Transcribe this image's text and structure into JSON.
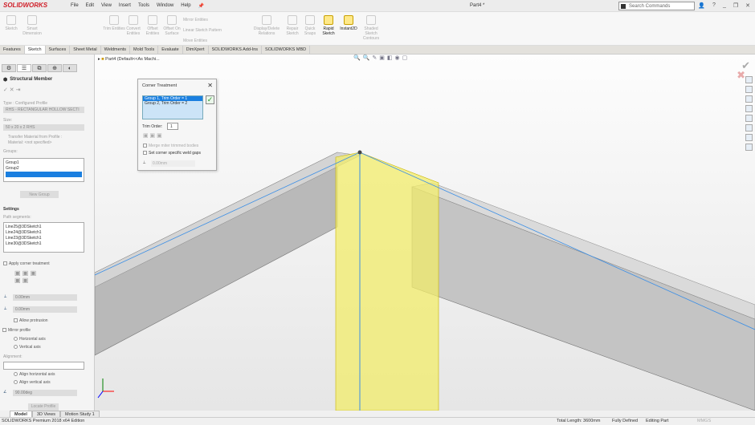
{
  "app": {
    "logo": "SOLIDWORKS",
    "document_title": "Part4 *",
    "search_placeholder": "Search Commands",
    "menu": [
      "File",
      "Edit",
      "View",
      "Insert",
      "Tools",
      "Window",
      "Help"
    ]
  },
  "ribbon": {
    "buttons": [
      "Sketch",
      "Smart Dimension",
      "Trim Entities",
      "Convert Entities",
      "Offset Entities",
      "Offset On Surface",
      "Display/Delete Relations",
      "Repair Sketch",
      "Quick Snaps",
      "Rapid Sketch",
      "Instant2D",
      "Shaded Sketch Contours"
    ],
    "small": [
      "Mirror Entities",
      "Linear Sketch Pattern",
      "Move Entities"
    ]
  },
  "tabs": [
    "Features",
    "Sketch",
    "Surfaces",
    "Sheet Metal",
    "Weldments",
    "Mold Tools",
    "Evaluate",
    "DimXpert",
    "SOLIDWORKS Add-Ins",
    "SOLIDWORKS MBD"
  ],
  "tree": {
    "part_label": "Part4 (Default<<As Machi..."
  },
  "panel": {
    "title": "Structural Member",
    "type_label": "Type : Configured Profile",
    "type_value": "RHS - RECTANGULAR HOLLOW SECTI",
    "size_label": "Size:",
    "size_value": "50 x 20 x 2 RHS",
    "transfer_material": "Transfer Material from Profile :",
    "material": "Material: <not specified>",
    "groups_label": "Groups:",
    "groups": [
      "Group1",
      "Group2",
      ""
    ],
    "new_group": "New Group",
    "settings": "Settings",
    "path_segments_label": "Path segments:",
    "path_segments": [
      "Line25@3DSketch1",
      "Line24@3DSketch1",
      "Line23@3DSketch1",
      "Line30@3DSketch1"
    ],
    "apply_corner": "Apply corner treatment",
    "gap1": "0.00mm",
    "gap2": "0.00mm",
    "allow_protrusion": "Allow protrusion",
    "mirror_profile": "Mirror profile",
    "horizontal_axis": "Horizontal axis",
    "vertical_axis": "Vertical axis",
    "alignment_label": "Alignment:",
    "align_h": "Align horizontal axis",
    "align_v": "Align vertical axis",
    "angle": "90.00deg",
    "locate_profile": "Locate Profile"
  },
  "dialog": {
    "title": "Corner Treatment",
    "items": [
      "Group 1, Trim Order = 1",
      "Group 2, Trim Order = 2"
    ],
    "trim_order_label": "Trim Order:",
    "trim_order": "1",
    "merge": "Merge miter trimmed bodies",
    "weld_gaps": "Set corner specific weld gaps",
    "gap": "0.00mm"
  },
  "model_tabs": [
    "Model",
    "3D Views",
    "Motion Study 1"
  ],
  "status": {
    "edition": "SOLIDWORKS Premium 2018 x64 Edition",
    "total_length": "Total Length: 3600mm",
    "defined": "Fully Defined",
    "editing": "Editing Part",
    "units": "MMGS"
  },
  "colors": {
    "accent": "#1a7fe0",
    "highlight": "#f2ec6a",
    "edge": "#3a8ee6"
  }
}
